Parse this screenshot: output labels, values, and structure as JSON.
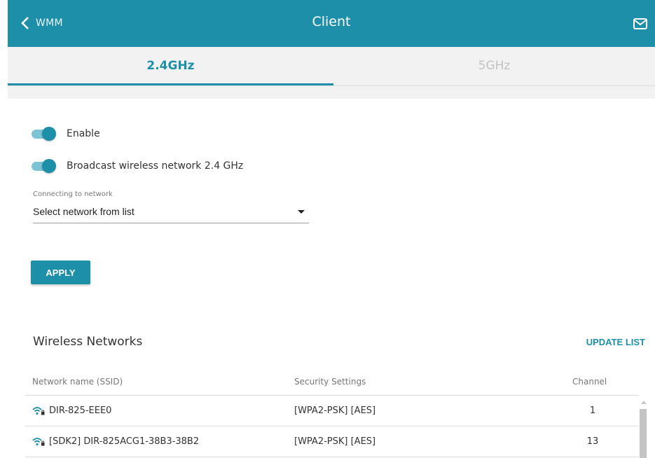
{
  "header": {
    "back_label": "WMM",
    "title": "Client"
  },
  "tabs": [
    {
      "label": "2.4GHz",
      "active": true
    },
    {
      "label": "5GHz",
      "active": false
    }
  ],
  "form": {
    "enable_label": "Enable",
    "enable_on": true,
    "broadcast_label": "Broadcast wireless network 2.4 GHz",
    "broadcast_on": true,
    "connect_label": "Connecting to network",
    "connect_value": "Select network from list",
    "apply_label": "APPLY"
  },
  "networks": {
    "title": "Wireless Networks",
    "update_label": "UPDATE LIST",
    "columns": [
      "Network name (SSID)",
      "Security Settings",
      "Channel"
    ],
    "rows": [
      {
        "ssid": "DIR-825-EEE0",
        "security": "[WPA2-PSK] [AES]",
        "channel": "1"
      },
      {
        "ssid": "[SDK2] DIR-825ACG1-38B3-38B2",
        "security": "[WPA2-PSK] [AES]",
        "channel": "13"
      }
    ]
  },
  "colors": {
    "accent": "#1e8fa8",
    "toggle_track": "#7cc3d3",
    "tab_bg": "#f2f2f2"
  },
  "icons": [
    "chevron-left-icon",
    "mail-icon",
    "wifi-lock-icon",
    "chevron-down-icon"
  ]
}
